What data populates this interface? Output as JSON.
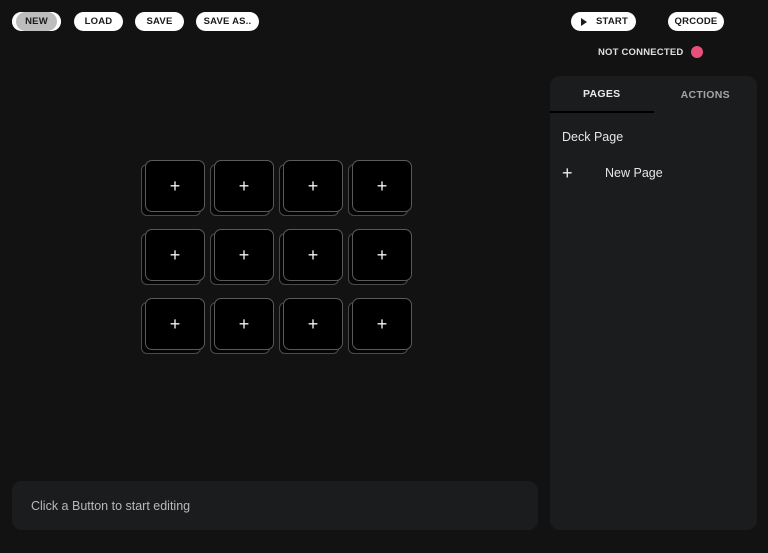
{
  "toolbar": {
    "new_label": "NEW",
    "load_label": "LOAD",
    "save_label": "SAVE",
    "save_as_label": "SAVE AS..",
    "start_label": "START",
    "qrcode_label": "QRCODE"
  },
  "connection": {
    "status_text": "NOT CONNECTED",
    "status_color": "#e8507a"
  },
  "deck": {
    "rows": 3,
    "cols": 4,
    "key_symbol": "+"
  },
  "editor": {
    "placeholder": "Click a Button to start editing"
  },
  "panel": {
    "tabs": [
      {
        "label": "PAGES",
        "active": true
      },
      {
        "label": "ACTIONS",
        "active": false
      }
    ],
    "pages": [
      {
        "label": "Deck Page"
      }
    ],
    "new_page_label": "New Page",
    "new_page_icon": "+"
  }
}
